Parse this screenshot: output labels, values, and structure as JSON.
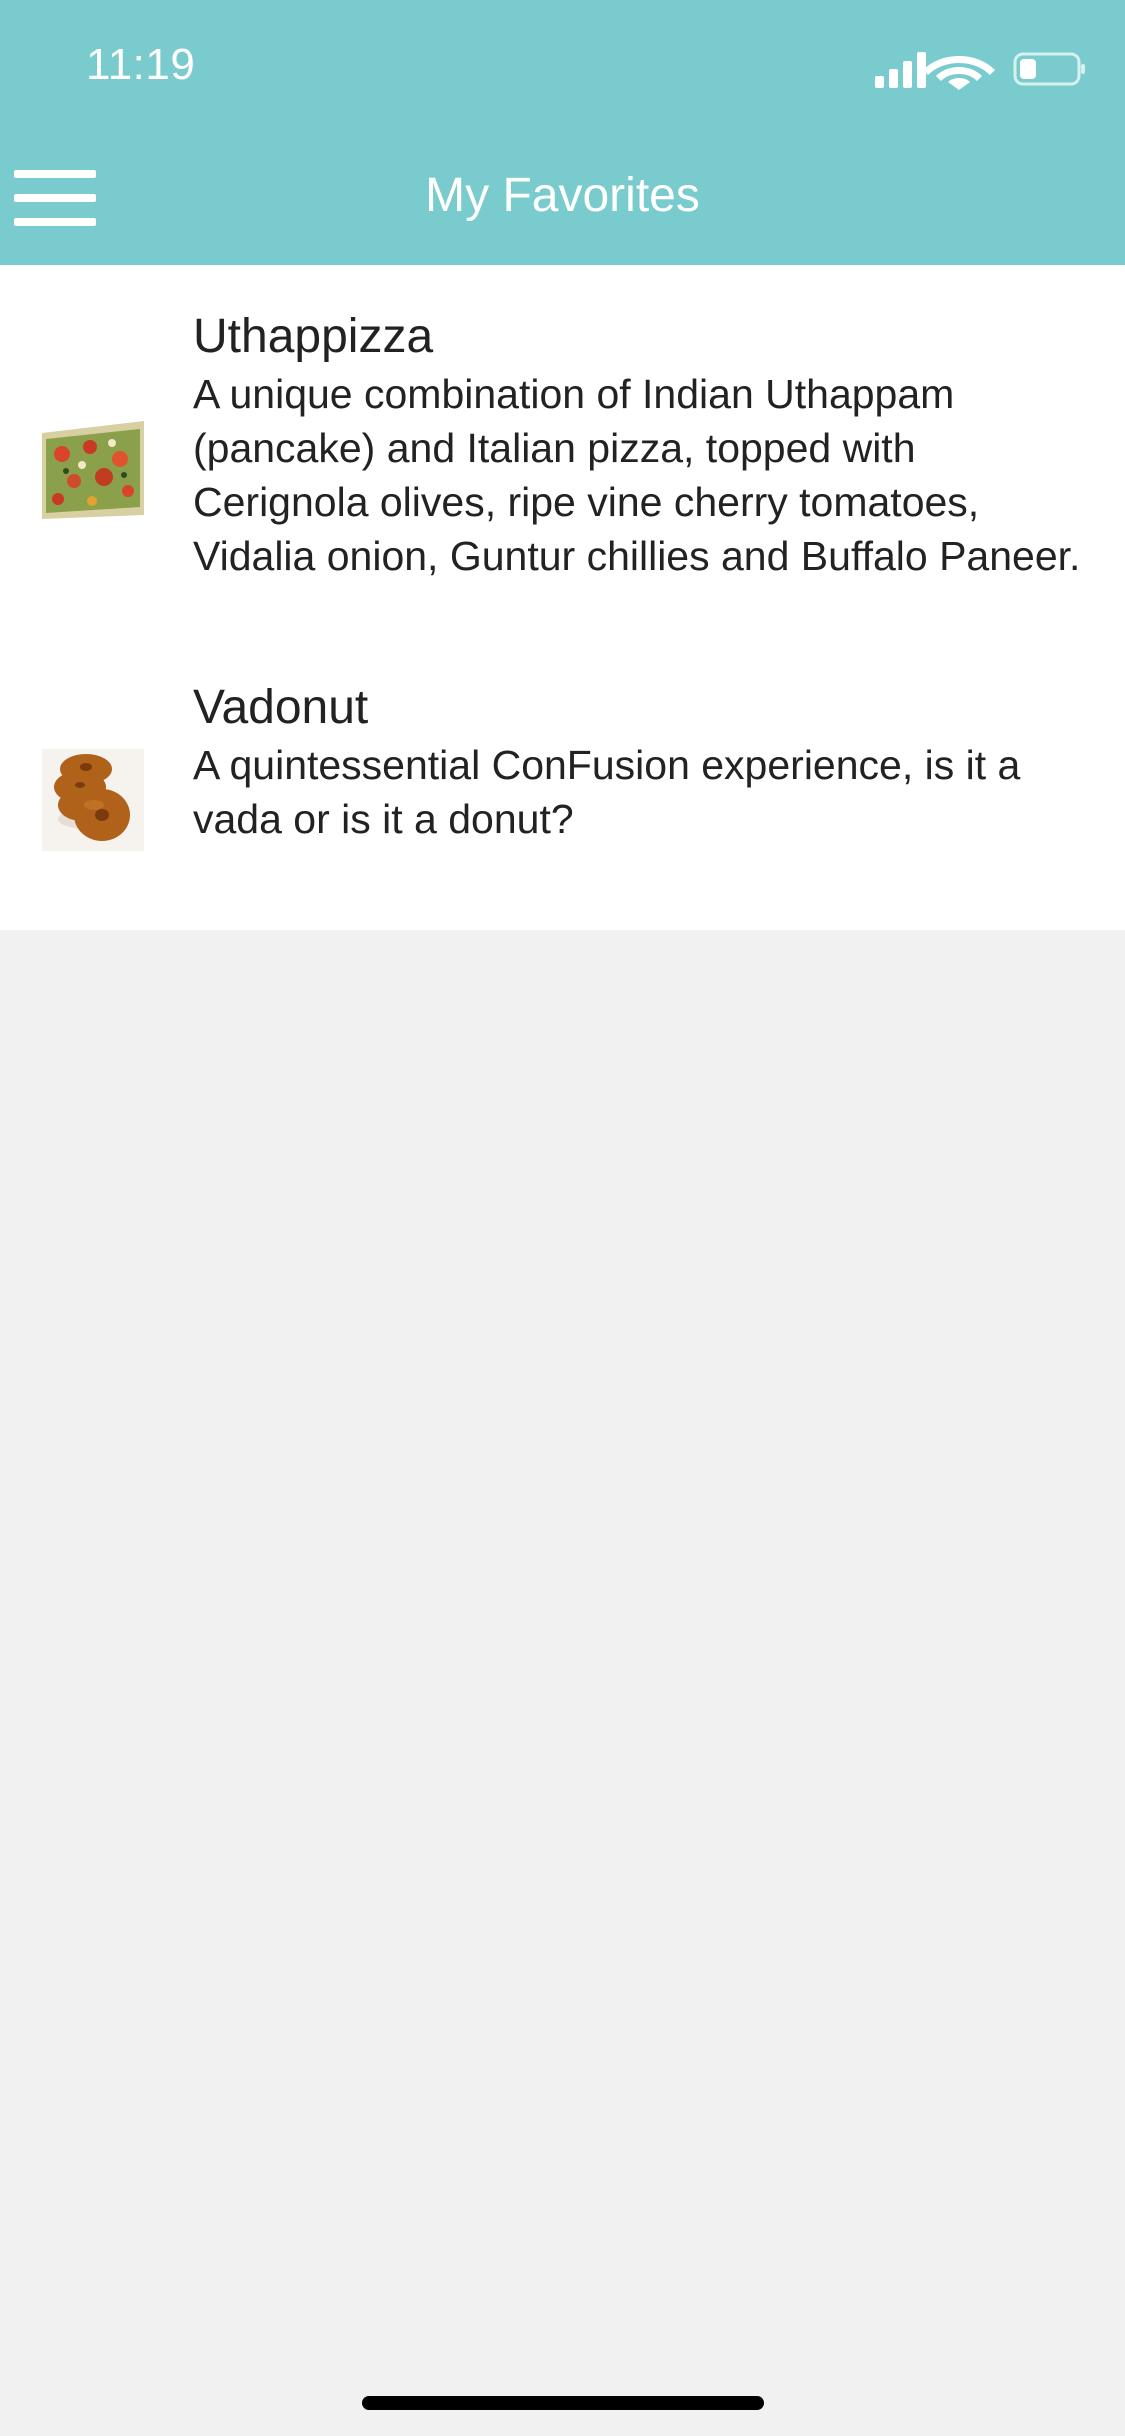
{
  "status_bar": {
    "time": "11:19",
    "icons": [
      "signal-icon",
      "wifi-icon",
      "battery-icon"
    ]
  },
  "header": {
    "title": "My Favorites",
    "menu_icon": "hamburger-menu-icon",
    "background": "#79cbcd"
  },
  "favorites": [
    {
      "name": "Uthappizza",
      "description": "A unique combination of Indian Uthappam (pancake) and Italian pizza, topped with Cerignola olives, ripe vine cherry tomatoes, Vidalia onion, Guntur chillies and Buffalo Paneer.",
      "image_icon": "pizza-thumbnail"
    },
    {
      "name": "Vadonut",
      "description": "A quintessential ConFusion experience, is it a vada or is it a donut?",
      "image_icon": "vadonut-thumbnail"
    }
  ]
}
